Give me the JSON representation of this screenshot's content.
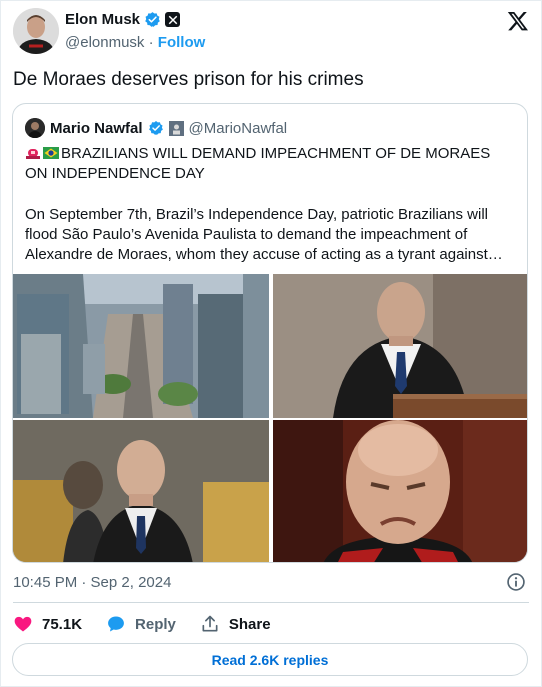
{
  "author": {
    "name": "Elon Musk",
    "handle": "@elonmusk",
    "separator": "·",
    "follow_label": "Follow"
  },
  "tweet": {
    "text": "De Moraes deserves prison for his crimes",
    "timestamp": "10:45 PM · Sep 2, 2024"
  },
  "quote": {
    "name": "Mario Nawfal",
    "handle": "@MarioNawfal",
    "title": "BRAZILIANS WILL DEMAND IMPEACHMENT OF DE MORAES ON INDEPENDENCE DAY",
    "body": "On September 7th, Brazil’s Independence Day, patriotic Brazilians will flood São Paulo’s Avenida Paulista to demand the impeachment of Alexandre de Moraes, whom they accuse of acting as a tyrant against…",
    "emoji": [
      "siren-emoji",
      "brazil-flag-emoji"
    ]
  },
  "actions": {
    "likes": "75.1K",
    "reply_label": "Reply",
    "share_label": "Share",
    "read_replies_label": "Read 2.6K replies"
  },
  "colors": {
    "accent": "#1d9bf0",
    "like": "#f91880",
    "link": "#006fd6",
    "text": "#0f1419",
    "muted": "#536471",
    "border": "#cfd9de"
  },
  "icons": {
    "verified": "verified-badge-icon",
    "x_logo": "x-logo-icon",
    "info": "info-icon",
    "like": "heart-icon",
    "reply": "reply-bubble-icon",
    "share": "share-icon"
  }
}
